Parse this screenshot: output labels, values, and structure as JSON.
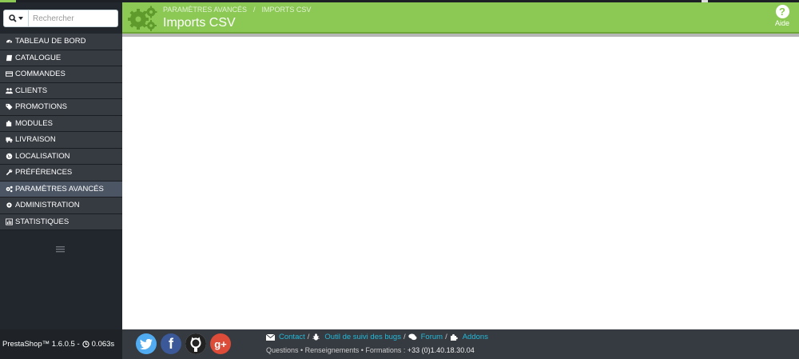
{
  "search": {
    "placeholder": "Rechercher"
  },
  "sidebar": {
    "items": [
      {
        "label": "TABLEAU DE BORD",
        "icon": "dashboard-icon"
      },
      {
        "label": "CATALOGUE",
        "icon": "book-icon"
      },
      {
        "label": "COMMANDES",
        "icon": "credit-card-icon"
      },
      {
        "label": "CLIENTS",
        "icon": "users-icon"
      },
      {
        "label": "PROMOTIONS",
        "icon": "tags-icon"
      },
      {
        "label": "MODULES",
        "icon": "puzzle-icon"
      },
      {
        "label": "LIVRAISON",
        "icon": "truck-icon"
      },
      {
        "label": "LOCALISATION",
        "icon": "globe-icon"
      },
      {
        "label": "PRÉFÉRENCES",
        "icon": "wrench-icon"
      },
      {
        "label": "PARAMÈTRES AVANCÉS",
        "icon": "cogs-icon",
        "active": true
      },
      {
        "label": "ADMINISTRATION",
        "icon": "cog-icon"
      },
      {
        "label": "STATISTIQUES",
        "icon": "bar-chart-icon"
      }
    ]
  },
  "header": {
    "breadcrumb": [
      "PARAMÈTRES AVANCÉS",
      "/",
      "IMPORTS CSV"
    ],
    "title": "Imports CSV",
    "help_label": "Aide",
    "accent": "#8bc954"
  },
  "footer": {
    "version": "PrestaShop™ 1.6.0.5 -",
    "time": "0.063s",
    "links": [
      {
        "label": "Contact",
        "sep": "/"
      },
      {
        "label": "Outil de suivi des bugs",
        "sep": "/"
      },
      {
        "label": "Forum",
        "sep": "/"
      },
      {
        "label": "Addons",
        "sep": ""
      }
    ],
    "info_text": "Questions • Renseignements • Formations : ",
    "phone": "+33 (0)1.40.18.30.04",
    "social": [
      "twitter-icon",
      "facebook-icon",
      "github-icon",
      "google-plus-icon"
    ]
  }
}
